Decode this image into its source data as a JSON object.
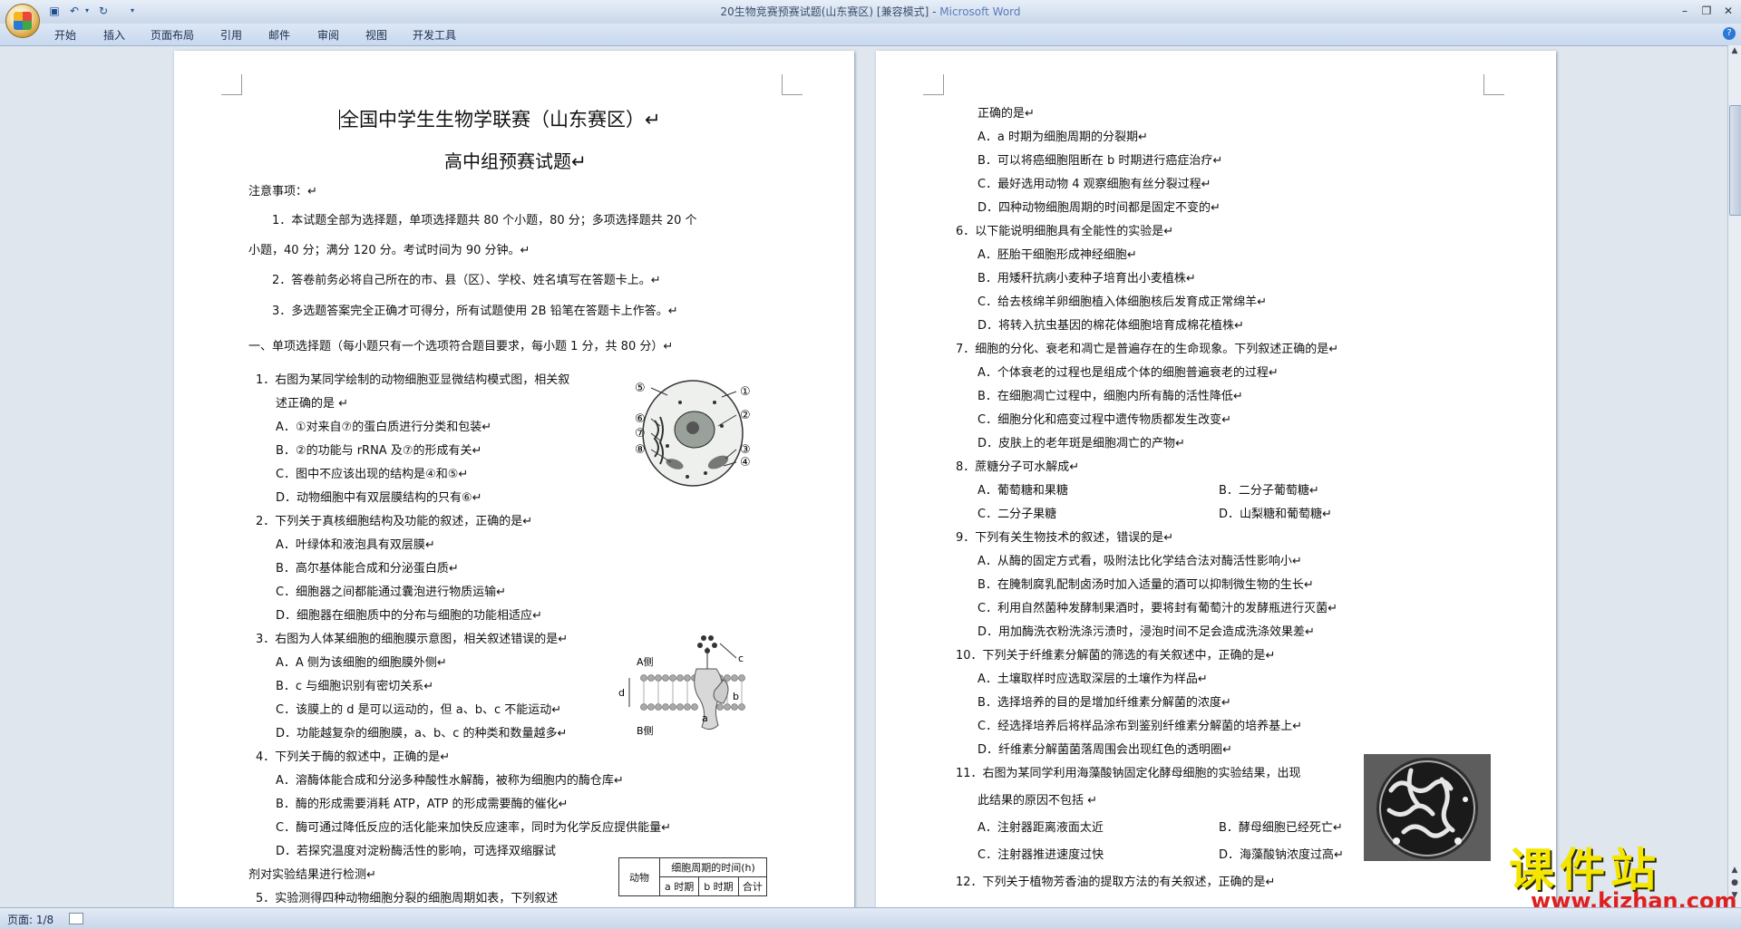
{
  "window": {
    "title": "20生物竞赛预赛试题(山东赛区) [兼容模式] - ",
    "app_name": "Microsoft Word"
  },
  "ribbon": {
    "tabs": [
      "开始",
      "插入",
      "页面布局",
      "引用",
      "邮件",
      "审阅",
      "视图",
      "开发工具"
    ]
  },
  "statusbar": {
    "page_indicator": "页面: 1/8"
  },
  "page1": {
    "title": "全国中学生生物学联赛（山东赛区）↵",
    "subtitle": "高中组预赛试题↵",
    "lines": [
      "注意事项：↵",
      "1．本试题全部为选择题，单项选择题共 80 个小题，80 分；多项选择题共 20 个",
      "小题，40 分；满分 120 分。考试时间为 90 分钟。↵",
      "2．答卷前务必将自己所在的市、县（区）、学校、姓名填写在答题卡上。↵",
      "3．多选题答案完全正确才可得分，所有试题使用 2B 铅笔在答题卡上作答。↵",
      "一、单项选择题（每小题只有一个选项符合题目要求，每小题 1 分，共 80 分）↵",
      "1．右图为某同学绘制的动物细胞亚显微结构模式图，相关叙",
      "述正确的是 ↵",
      "A．①对来自⑦的蛋白质进行分类和包装↵",
      "B．②的功能与 rRNA 及⑦的形成有关↵",
      "C．图中不应该出现的结构是④和⑤↵",
      "D．动物细胞中有双层膜结构的只有⑥↵",
      "2．下列关于真核细胞结构及功能的叙述，正确的是↵",
      "A．叶绿体和液泡具有双层膜↵",
      "B．高尔基体能合成和分泌蛋白质↵",
      "C．细胞器之间都能通过囊泡进行物质运输↵",
      "D．细胞器在细胞质中的分布与细胞的功能相适应↵",
      "3．右图为人体某细胞的细胞膜示意图，相关叙述错误的是↵",
      "A．A 侧为该细胞的细胞膜外侧↵",
      "B．c 与细胞识别有密切关系↵",
      "C．该膜上的 d 是可以运动的，但 a、b、c 不能运动↵",
      "D．功能越复杂的细胞膜，a、b、c 的种类和数量越多↵",
      "4．下列关于酶的叙述中，正确的是↵",
      "A．溶酶体能合成和分泌多种酸性水解酶，被称为细胞内的酶仓库↵",
      "B．酶的形成需要消耗 ATP，ATP 的形成需要酶的催化↵",
      "C．酶可通过降低反应的活化能来加快反应速率，同时为化学反应提供能量↵",
      "D．若探究温度对淀粉酶活性的影响，可选择双缩脲试",
      "剂对实验结果进行检测↵",
      "5．实验测得四种动物细胞分裂的细胞周期如表，下列叙述"
    ],
    "cell_labels": [
      "⑤",
      "①",
      "⑥",
      "②",
      "⑦",
      "⑧",
      "③",
      "④"
    ],
    "membrane_labels": {
      "a_side": "A侧",
      "b_side": "B侧",
      "c": "c",
      "d": "d",
      "a": "a",
      "b": "b"
    },
    "table": {
      "head_animal": "动物",
      "head_time": "细胞周期的时间(h)",
      "col_a": "a 时期",
      "col_b": "b 时期",
      "col_total": "合计"
    }
  },
  "page2": {
    "lines": [
      "正确的是↵",
      "A．a 时期为细胞周期的分裂期↵",
      "B．可以将癌细胞阻断在 b 时期进行癌症治疗↵",
      "C．最好选用动物 4 观察细胞有丝分裂过程↵",
      "D．四种动物细胞周期的时间都是固定不变的↵",
      "6．以下能说明细胞具有全能性的实验是↵",
      "A．胚胎干细胞形成神经细胞↵",
      "B．用矮秆抗病小麦种子培育出小麦植株↵",
      "C．给去核绵羊卵细胞植入体细胞核后发育成正常绵羊↵",
      "D．将转入抗虫基因的棉花体细胞培育成棉花植株↵",
      "7．细胞的分化、衰老和凋亡是普遍存在的生命现象。下列叙述正确的是↵",
      "A．个体衰老的过程也是组成个体的细胞普遍衰老的过程↵",
      "B．在细胞凋亡过程中，细胞内所有酶的活性降低↵",
      "C．细胞分化和癌变过程中遗传物质都发生改变↵",
      "D．皮肤上的老年斑是细胞凋亡的产物↵",
      "8．蔗糖分子可水解成↵",
      "A．葡萄糖和果糖",
      "B．二分子葡萄糖↵",
      "C．二分子果糖",
      "D．山梨糖和葡萄糖↵",
      "9．下列有关生物技术的叙述，错误的是↵",
      "A．从酶的固定方式看，吸附法比化学结合法对酶活性影响小↵",
      "B．在腌制腐乳配制卤汤时加入适量的酒可以抑制微生物的生长↵",
      "C．利用自然菌种发酵制果酒时，要将封有葡萄汁的发酵瓶进行灭菌↵",
      "D．用加酶洗衣粉洗涤污渍时，浸泡时间不足会造成洗涤效果差↵",
      "10．下列关于纤维素分解菌的筛选的有关叙述中，正确的是↵",
      "A．土壤取样时应选取深层的土壤作为样品↵",
      "B．选择培养的目的是增加纤维素分解菌的浓度↵",
      "C．经选择培养后将样品涂布到鉴别纤维素分解菌的培养基上↵",
      "D．纤维素分解菌菌落周围会出现红色的透明圈↵",
      "11．右图为某同学利用海藻酸钠固定化酵母细胞的实验结果，出现",
      "此结果的原因不包括 ↵",
      "A．注射器距离液面太近",
      "B．酵母细胞已经死亡↵",
      "C．注射器推进速度过快",
      "D．海藻酸钠浓度过高↵",
      "12．下列关于植物芳香油的提取方法的有关叙述，正确的是↵"
    ]
  },
  "watermark": {
    "text": "课件站",
    "url": "www.kjzhan.com"
  }
}
